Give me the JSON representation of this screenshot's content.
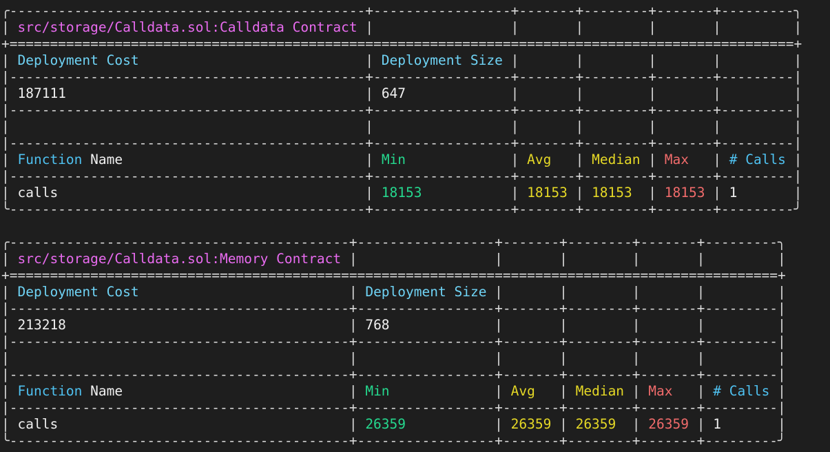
{
  "tables": [
    {
      "title": "src/storage/Calldata.sol:Calldata Contract",
      "deployment_cost_label": "Deployment Cost",
      "deployment_size_label": "Deployment Size",
      "deployment_cost": "187111",
      "deployment_size": "647",
      "headers": {
        "function_word": "Function",
        "name_word": "Name",
        "min": "Min",
        "avg": "Avg",
        "median": "Median",
        "max": "Max",
        "calls": "# Calls"
      },
      "rows": [
        {
          "name": "calls",
          "min": "18153",
          "avg": "18153",
          "median": "18153",
          "max": "18153",
          "calls": "1"
        }
      ]
    },
    {
      "title": "src/storage/Calldata.sol:Memory Contract",
      "deployment_cost_label": "Deployment Cost",
      "deployment_size_label": "Deployment Size",
      "deployment_cost": "213218",
      "deployment_size": "768",
      "headers": {
        "function_word": "Function",
        "name_word": "Name",
        "min": "Min",
        "avg": "Avg",
        "median": "Median",
        "max": "Max",
        "calls": "# Calls"
      },
      "rows": [
        {
          "name": "calls",
          "min": "26359",
          "avg": "26359",
          "median": "26359",
          "max": "26359",
          "calls": "1"
        }
      ]
    }
  ],
  "colors": {
    "background": "#1e1e1e",
    "title": "#e96bf0",
    "header": "#6fd3f5",
    "min": "#25d88e",
    "avg_median": "#e5d826",
    "max": "#f06b6b"
  }
}
